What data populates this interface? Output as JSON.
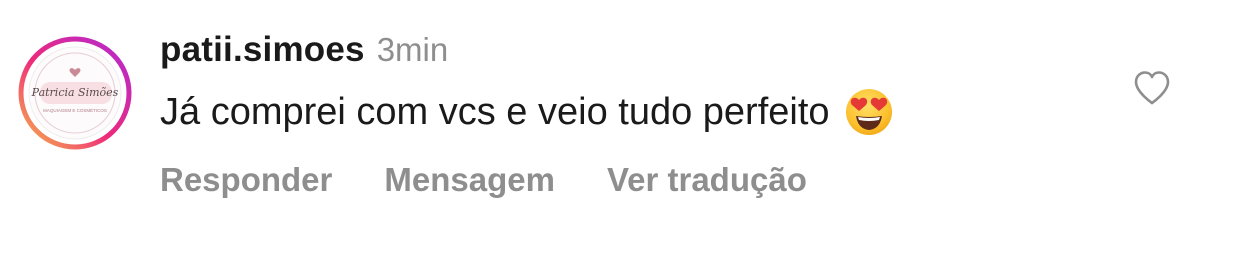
{
  "comment": {
    "avatar": {
      "icon": "profile-picture",
      "logo_name": "Patricia Simões",
      "logo_tagline": "MAQUIAGEM E COSMÉTICOS",
      "ring_colors": [
        "#f6b84a",
        "#ee2a7b",
        "#b02ad6"
      ]
    },
    "username": "patii.simoes",
    "time": "3min",
    "text": "Já comprei com vcs e veio tudo perfeito",
    "emoji": "smiling-face-with-heart-eyes",
    "actions": {
      "reply": "Responder",
      "message": "Mensagem",
      "translate": "Ver tradução"
    },
    "like_icon": "heart-outline-icon"
  },
  "colors": {
    "text": "#1a1a1a",
    "secondary": "#8e8e8e",
    "background": "#ffffff"
  }
}
